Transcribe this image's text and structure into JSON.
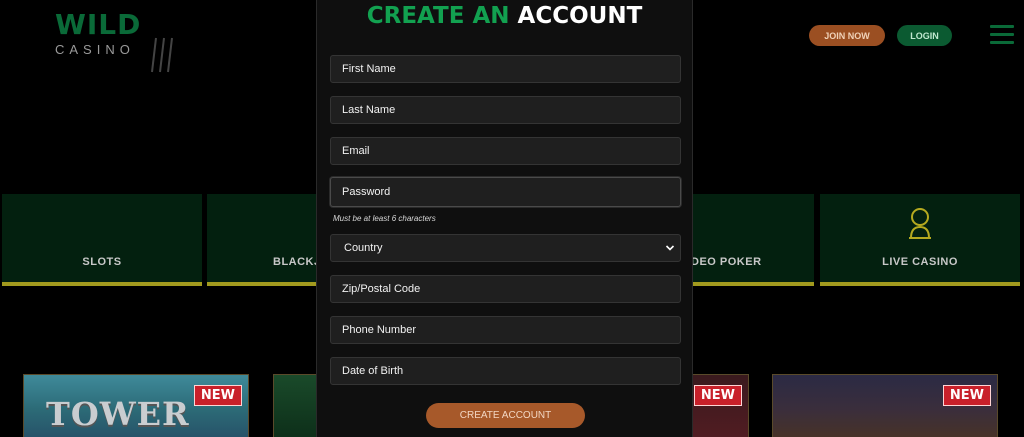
{
  "header": {
    "logo_word": "WILD",
    "logo_sub": "CASINO",
    "join_label": "JOIN NOW",
    "login_label": "LOGIN"
  },
  "categories": [
    {
      "label": "SLOTS"
    },
    {
      "label": "BLACKJ"
    },
    {
      "label": "DEO POKER"
    },
    {
      "label": "LIVE CASINO"
    }
  ],
  "games": [
    {
      "title_art": "TOWER",
      "badge": "NEW"
    },
    {
      "badge": "NEW"
    },
    {
      "badge": "NEW"
    }
  ],
  "modal": {
    "title_part1": "CREATE AN",
    "title_part2": "ACCOUNT",
    "fields": [
      {
        "placeholder": "First Name"
      },
      {
        "placeholder": "Last Name"
      },
      {
        "placeholder": "Email"
      },
      {
        "placeholder": "Password"
      },
      {
        "placeholder": "Country"
      },
      {
        "placeholder": "Zip/Postal Code"
      },
      {
        "placeholder": "Phone Number"
      },
      {
        "placeholder": "Date of Birth"
      }
    ],
    "password_hint": "Must be at least 6 characters",
    "submit_label": "CREATE ACCOUNT"
  },
  "colors": {
    "brand_green": "#12a150",
    "join_orange": "#9b4f22",
    "category_underline": "#a29a1e",
    "new_badge_red": "#c8202a"
  }
}
